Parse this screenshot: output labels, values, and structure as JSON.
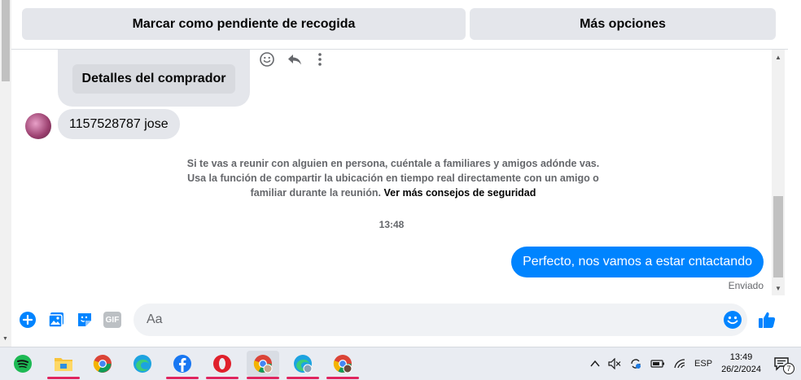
{
  "top_actions": {
    "mark_pending": "Marcar como pendiente de recogida",
    "more_options": "Más opciones"
  },
  "chat": {
    "buyer_details_button": "Detalles del comprador",
    "incoming_message": "1157528787 jose",
    "safety_notice": "Si te vas a reunir con alguien en persona, cuéntale a familiares y amigos adónde vas. Usa la función de compartir la ubicación en tiempo real directamente con un amigo o familiar durante la reunión.",
    "safety_link": "Ver más consejos de seguridad",
    "timestamp": "13:48",
    "outgoing_message": "Perfecto, nos vamos a estar cntactando",
    "sent_status": "Enviado"
  },
  "composer": {
    "placeholder": "Aa",
    "icons": [
      "plus-circle-icon",
      "photo-icon",
      "sticker-icon",
      "gif-icon",
      "emoji-icon",
      "like-icon"
    ],
    "gif_label": "GIF"
  },
  "colors": {
    "accent": "#0084ff",
    "bubble_gray": "#e4e6eb",
    "muted_text": "#65676b"
  },
  "taskbar": {
    "apps": [
      "spotify",
      "file-explorer",
      "chrome",
      "edge",
      "facebook",
      "opera",
      "chrome-profile",
      "edge-profile",
      "chrome-profile-2"
    ],
    "language": "ESP",
    "time": "13:49",
    "date": "26/2/2024",
    "notifications": "7"
  }
}
